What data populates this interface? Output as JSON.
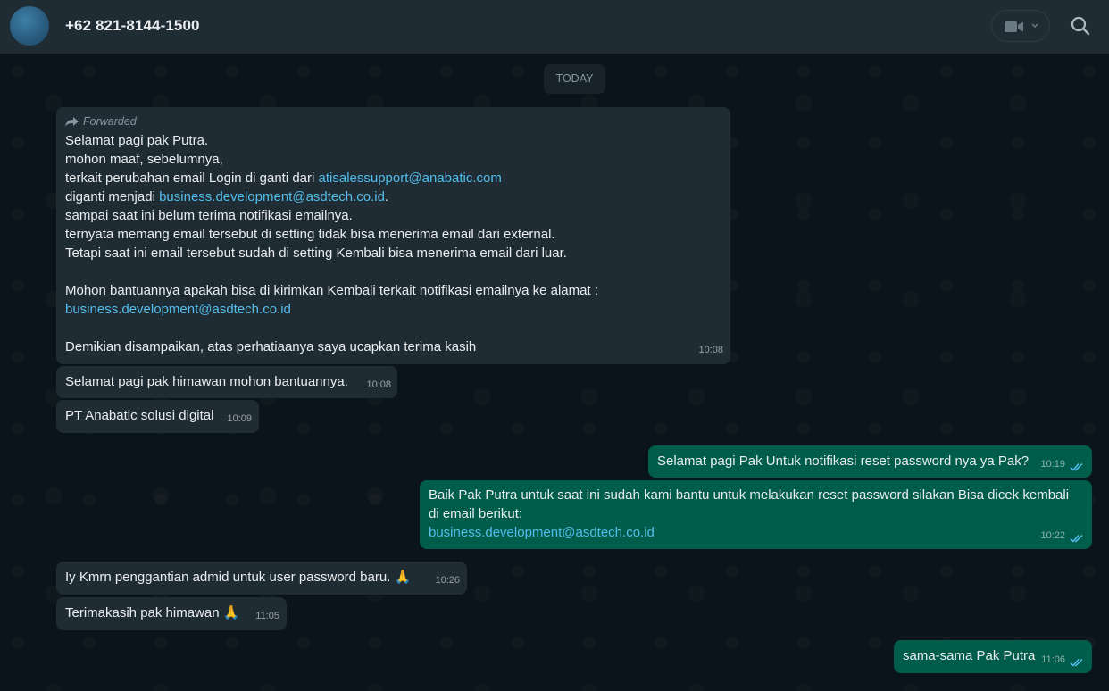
{
  "header": {
    "contact_name": "+62 821-8144-1500",
    "icons": [
      "avatar",
      "video-call-icon",
      "chevron-down-icon",
      "search-icon"
    ]
  },
  "chat": {
    "date_label": "TODAY",
    "messages": [
      {
        "direction": "in",
        "forwarded_label": "Forwarded",
        "lines": [
          "Selamat pagi pak Putra.",
          "mohon maaf, sebelumnya,",
          "terkait perubahan email Login di ganti dari ",
          "atisalessupport@anabatic.com",
          "diganti menjadi ",
          "business.development@asdtech.co.id",
          ".",
          "sampai saat ini belum terima notifikasi emailnya.",
          "ternyata memang email tersebut di setting tidak bisa menerima email dari external.",
          "Tetapi saat ini email tersebut sudah di setting Kembali bisa menerima email dari luar.",
          "Mohon bantuannya apakah bisa di kirimkan Kembali terkait notifikasi emailnya ke alamat :",
          "business.development@asdtech.co.id",
          "Demikian disampaikan, atas perhatiaanya saya ucapkan terima kasih"
        ],
        "time": "10:08"
      },
      {
        "direction": "in",
        "text": "Selamat pagi pak himawan mohon bantuannya.",
        "time": "10:08"
      },
      {
        "direction": "in",
        "text": "PT Anabatic solusi digital",
        "time": "10:09"
      },
      {
        "direction": "out",
        "text": "Selamat pagi Pak Untuk notifikasi reset password nya ya Pak?",
        "time": "10:19",
        "status": "read"
      },
      {
        "direction": "out",
        "lines": [
          "Baik Pak Putra untuk saat ini sudah kami bantu untuk melakukan reset password silakan Bisa dicek kembali",
          "di email berikut:",
          "business.development@asdtech.co.id"
        ],
        "time": "10:22",
        "status": "read"
      },
      {
        "direction": "in",
        "text": "Iy Kmrn penggantian admid untuk user password baru. ",
        "emoji": "🙏",
        "time": "10:26"
      },
      {
        "direction": "in",
        "text": "Terimakasih pak himawan ",
        "emoji": "🙏",
        "time": "11:05"
      },
      {
        "direction": "out",
        "text": "sama-sama Pak Putra",
        "time": "11:06",
        "status": "read"
      }
    ]
  },
  "colors": {
    "incoming_bubble": "#202c33",
    "outgoing_bubble": "#005c4b",
    "link": "#53bdeb",
    "read_ticks": "#53bdeb"
  }
}
